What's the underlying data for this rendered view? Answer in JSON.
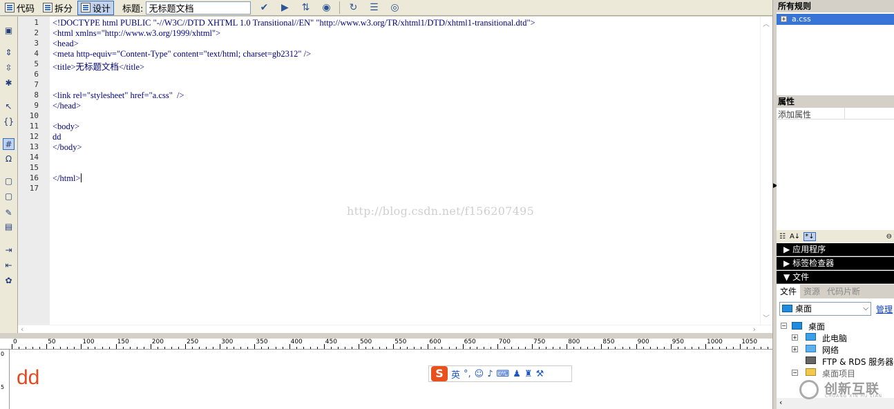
{
  "toolbar": {
    "code_label": "代码",
    "split_label": "拆分",
    "design_label": "设计",
    "title_label": "标题:",
    "title_value": "无标题文档"
  },
  "editor": {
    "lines": [
      {
        "n": "1",
        "text": "<!DOCTYPE html PUBLIC \"-//W3C//DTD XHTML 1.0 Transitional//EN\" \"http://www.w3.org/TR/xhtml1/DTD/xhtml1-transitional.dtd\">"
      },
      {
        "n": "2",
        "text": "<html xmlns=\"http://www.w3.org/1999/xhtml\">"
      },
      {
        "n": "3",
        "text": "<head>"
      },
      {
        "n": "4",
        "text": "<meta http-equiv=\"Content-Type\" content=\"text/html; charset=gb2312\" />"
      },
      {
        "n": "5",
        "text": "<title>无标题文档</title>"
      },
      {
        "n": "6",
        "text": ""
      },
      {
        "n": "7",
        "text": ""
      },
      {
        "n": "8",
        "text": "<link rel=\"stylesheet\" href=\"a.css\"  />"
      },
      {
        "n": "9",
        "text": "</head>"
      },
      {
        "n": "10",
        "text": ""
      },
      {
        "n": "11",
        "text": "<body>"
      },
      {
        "n": "12",
        "text": "dd"
      },
      {
        "n": "13",
        "text": "</body>"
      },
      {
        "n": "14",
        "text": ""
      },
      {
        "n": "15",
        "text": ""
      },
      {
        "n": "16",
        "text": "</html>"
      },
      {
        "n": "17",
        "text": ""
      }
    ],
    "watermark": "http://blog.csdn.net/f156207495"
  },
  "ruler": {
    "labels": [
      "0",
      "50",
      "100",
      "150",
      "200",
      "250",
      "300",
      "350",
      "400",
      "450",
      "500",
      "550",
      "600",
      "650",
      "700",
      "750",
      "800",
      "850",
      "900",
      "950",
      "1000",
      "1050"
    ]
  },
  "design_view": {
    "content_text": "dd",
    "text_color": "#e4491f"
  },
  "ime": {
    "logo": "S",
    "mode": "英",
    "icons": [
      "punctuation-icon",
      "emoji-icon",
      "microphone-icon",
      "keyboard-icon",
      "user-icon",
      "shirt-icon",
      "wrench-icon"
    ]
  },
  "right_panel": {
    "rules_header": "所有规则",
    "rules_item": "a.css",
    "props_header": "属性",
    "add_property": "添加属性",
    "groups": [
      {
        "label": "应用程序",
        "arrow": "▶"
      },
      {
        "label": "标签检查器",
        "arrow": "▶"
      },
      {
        "label": "文件",
        "arrow": "▼"
      }
    ],
    "tabs": [
      "文件",
      "资源",
      "代码片断"
    ],
    "site_select": "桌面",
    "manage_link": "管理",
    "tree": [
      {
        "label": "桌面",
        "expander": "−"
      },
      {
        "label": "此电脑",
        "expander": "+"
      },
      {
        "label": "网络",
        "expander": "+"
      },
      {
        "label": "FTP & RDS 服务器",
        "expander": ""
      },
      {
        "label": "桌面项目",
        "expander": "−"
      }
    ]
  },
  "brand": {
    "name": "创新互联",
    "subtitle": "CHUANG XIN HU LIAN"
  },
  "colors": {
    "selection": "#3875d7",
    "panel_bg": "#d4d0c8",
    "accent_orange": "#e8501c"
  }
}
